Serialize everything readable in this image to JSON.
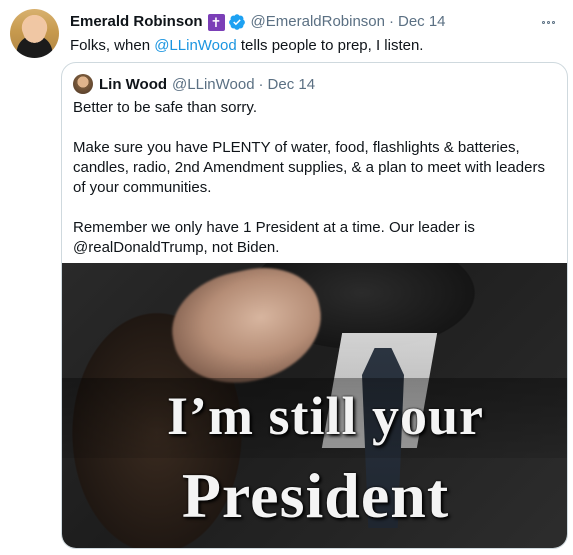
{
  "tweet": {
    "display_name": "Emerald Robinson",
    "badge_glyph": "✝",
    "handle": "@EmeraldRobinson",
    "separator": "·",
    "date": "Dec 14",
    "text_before": "Folks, when ",
    "mention": "@LLinWood",
    "text_after": " tells people to prep, I listen."
  },
  "quoted_tweet": {
    "display_name": "Lin Wood",
    "handle": "@LLinWood",
    "separator": "·",
    "date": "Dec 14",
    "paragraphs": [
      "Better to be safe than sorry.",
      "Make sure you have PLENTY of water, food, flashlights & batteries, candles, radio, 2nd Amendment supplies, & a plan to meet with leaders of your communities.",
      "Remember we only have 1 President at a time. Our leader is @realDonaldTrump, not Biden."
    ],
    "image_caption_line1": "I’m still your",
    "image_caption_line2": "President"
  },
  "colors": {
    "link": "#1b95e0",
    "verified": "#1da1f2",
    "secondary_text": "#5b7083",
    "badge": "#7b3fb7"
  },
  "icons": [
    "more-icon",
    "verified-badge-icon",
    "cross-badge-icon"
  ]
}
